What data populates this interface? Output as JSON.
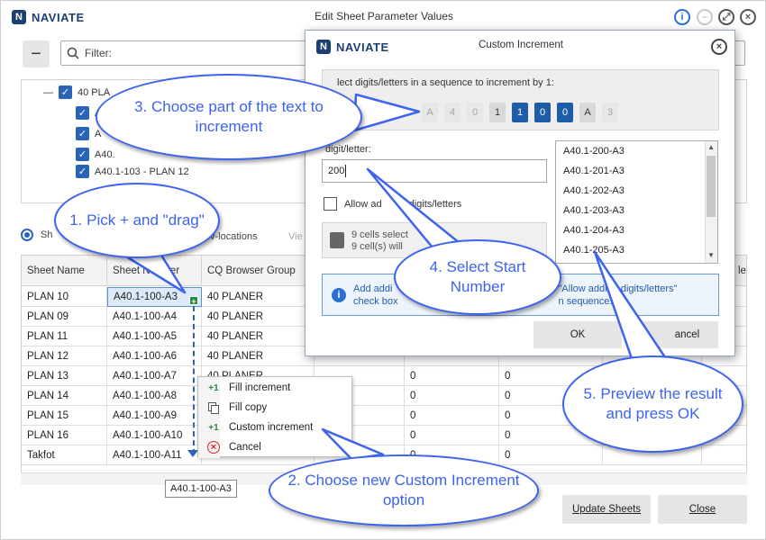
{
  "app": {
    "brand": "NAVIATE",
    "window_title": "Edit Sheet Parameter Values"
  },
  "toolbar": {
    "collapse_label": "−",
    "filter_placeholder": "Filter:"
  },
  "tree": {
    "root_label": "40 PLA",
    "items": [
      "A",
      "A",
      "A40.",
      "A40.1-103 - PLAN 12"
    ]
  },
  "view_options": {
    "radio_label": "Sh",
    "link1": "v-locations",
    "link2": "Vie"
  },
  "grid": {
    "columns": [
      "Sheet Name",
      "Sheet Number",
      "CQ Browser Group",
      "le"
    ],
    "rows": [
      {
        "name": "PLAN 10",
        "number": "A40.1-100-A3",
        "group": "40 PLANER",
        "v1": "",
        "v2": ""
      },
      {
        "name": "PLAN 09",
        "number": "A40.1-100-A4",
        "group": "40 PLANER",
        "v1": "",
        "v2": ""
      },
      {
        "name": "PLAN 11",
        "number": "A40.1-100-A5",
        "group": "40 PLANER",
        "v1": "",
        "v2": ""
      },
      {
        "name": "PLAN 12",
        "number": "A40.1-100-A6",
        "group": "40 PLANER",
        "v1": "",
        "v2": ""
      },
      {
        "name": "PLAN 13",
        "number": "A40.1-100-A7",
        "group": "40 PLANER",
        "v1": "0",
        "v2": "0"
      },
      {
        "name": "PLAN 14",
        "number": "A40.1-100-A8",
        "group": "",
        "v1": "0",
        "v2": "0"
      },
      {
        "name": "PLAN 15",
        "number": "A40.1-100-A9",
        "group": "",
        "v1": "0",
        "v2": "0"
      },
      {
        "name": "PLAN 16",
        "number": "A40.1-100-A10",
        "group": "",
        "v1": "0",
        "v2": "0"
      },
      {
        "name": "Takfot",
        "number": "A40.1-100-A11",
        "group": "",
        "v1": "0",
        "v2": "0"
      }
    ],
    "fill_handle": "+",
    "tooltip": "A40.1-100-A3"
  },
  "context_menu": {
    "items": [
      {
        "icon": "+1",
        "label": "Fill increment"
      },
      {
        "icon": "copy",
        "label": "Fill copy"
      },
      {
        "icon": "+1",
        "label": "Custom increment"
      },
      {
        "icon": "×",
        "label": "Cancel"
      }
    ]
  },
  "footer": {
    "update_label": "Update Sheets",
    "close_label": "Close"
  },
  "dialog": {
    "brand": "NAVIATE",
    "title": "Custom Increment",
    "sequence_label": "lect digits/letters in a sequence to increment by 1:",
    "chips": [
      {
        "char": "A",
        "state": "off"
      },
      {
        "char": "4",
        "state": "off"
      },
      {
        "char": "0",
        "state": "off"
      },
      {
        "char": "1",
        "state": "norm"
      },
      {
        "char": "1",
        "state": "on"
      },
      {
        "char": "0",
        "state": "on"
      },
      {
        "char": "0",
        "state": "on"
      },
      {
        "char": "A",
        "state": "norm"
      },
      {
        "char": "3",
        "state": "off"
      }
    ],
    "start_label": "digit/letter:",
    "start_value": "200",
    "allow_label": "Allow ad",
    "allow_label_end": "digits/letters",
    "info_line1": "9 cells select",
    "info_line2": "9 cell(s) will",
    "preview": [
      "A40.1-200-A3",
      "A40.1-201-A3",
      "A40.1-202-A3",
      "A40.1-203-A3",
      "A40.1-204-A3",
      "A40.1-205-A3"
    ],
    "hint_part1": "Add addi",
    "hint_part1b": "check box",
    "hint_part2": "\"Allow adding digits/letters\"",
    "hint_part2b": "n sequence.",
    "ok_label": "OK",
    "cancel_label": "ancel"
  },
  "callouts": {
    "c1": "1. Pick + and \"drag\"",
    "c2": "2. Choose new Custom Increment option",
    "c3": "3. Choose part of the text to increment",
    "c4": "4. Select Start Number",
    "c5": "5. Preview the result and press OK"
  }
}
